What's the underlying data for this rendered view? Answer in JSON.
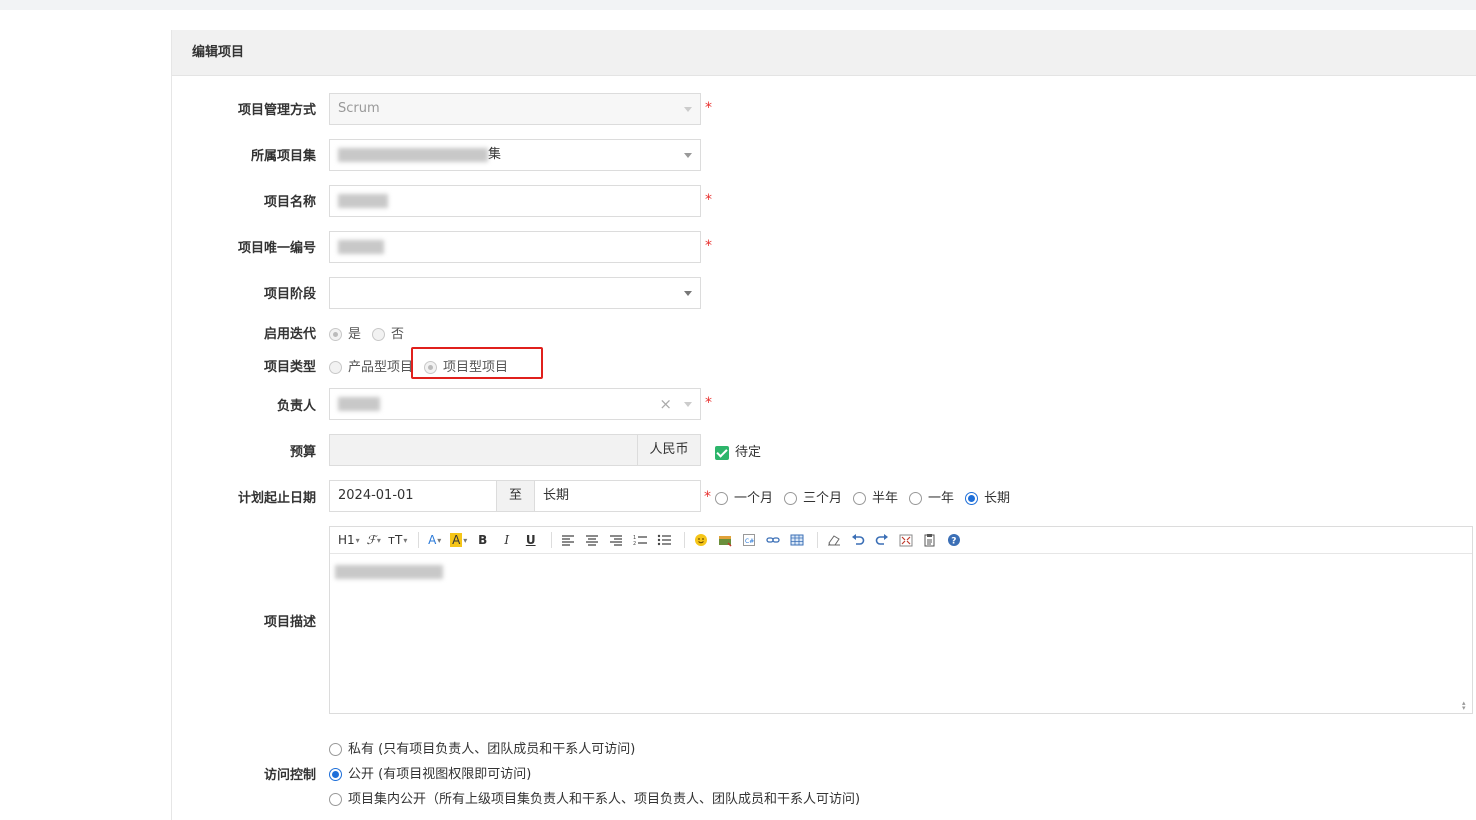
{
  "panel": {
    "title": "编辑项目"
  },
  "form": {
    "mgmt_mode": {
      "label": "项目管理方式",
      "value": "Scrum"
    },
    "program": {
      "label": "所属项目集",
      "value_suffix": "集"
    },
    "name": {
      "label": "项目名称"
    },
    "code": {
      "label": "项目唯一编号"
    },
    "stage": {
      "label": "项目阶段",
      "value": ""
    },
    "iteration": {
      "label": "启用迭代",
      "options": [
        "是",
        "否"
      ],
      "selected": "是"
    },
    "type": {
      "label": "项目类型",
      "options": [
        "产品型项目",
        "项目型项目"
      ],
      "selected": "项目型项目"
    },
    "owner": {
      "label": "负责人",
      "clear_icon": "×"
    },
    "budget": {
      "label": "预算",
      "value": "",
      "currency": "人民币",
      "tbd_label": "待定",
      "tbd_checked": true
    },
    "dates": {
      "label": "计划起止日期",
      "start": "2024-01-01",
      "separator": "至",
      "end": "长期",
      "quick_options": [
        "一个月",
        "三个月",
        "半年",
        "一年",
        "长期"
      ],
      "quick_selected": "长期"
    },
    "description": {
      "label": "项目描述",
      "toolbar": {
        "heading": "H1",
        "font": "ℱ",
        "size": "ᴛT",
        "font_color": "A",
        "bg_color": "A",
        "bold": "B",
        "italic": "I",
        "underline": "U",
        "icons": [
          "align-left-icon",
          "align-center-icon",
          "align-right-icon",
          "ordered-list-icon",
          "unordered-list-icon",
          "emoji-icon",
          "image-icon",
          "code-icon",
          "link-icon",
          "table-icon",
          "eraser-icon",
          "undo-icon",
          "redo-icon",
          "fullscreen-icon",
          "paste-icon",
          "help-icon"
        ]
      }
    },
    "access": {
      "label": "访问控制",
      "options": [
        "私有 (只有项目负责人、团队成员和干系人可访问)",
        "公开 (有项目视图权限即可访问)",
        "项目集内公开（所有上级项目集负责人和干系人、项目负责人、团队成员和干系人可访问)"
      ],
      "selected_index": 1
    },
    "required_mark": "*"
  }
}
